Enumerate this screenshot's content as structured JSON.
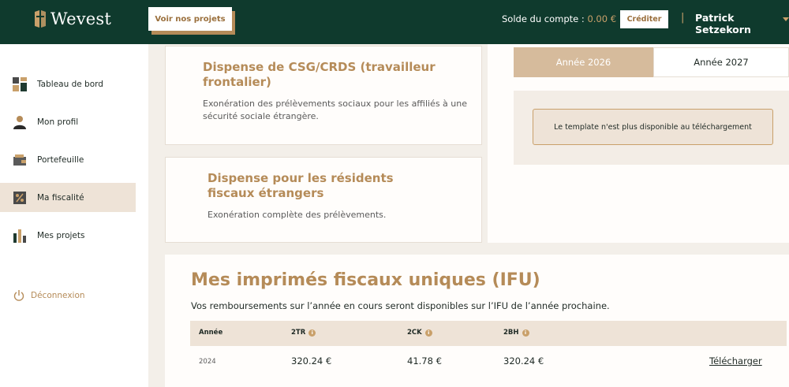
{
  "header": {
    "logo_text": "Wevest",
    "projects_button": "Voir nos projets",
    "balance_label": "Solde du compte :",
    "balance_value": "0.00 €",
    "credit_button": "Créditer",
    "separator": "|",
    "user_name": "Patrick Setzekorn"
  },
  "sidebar": {
    "items": [
      {
        "label": "Tableau de bord",
        "icon": "dashboard-icon"
      },
      {
        "label": "Mon profil",
        "icon": "user-icon"
      },
      {
        "label": "Portefeuille",
        "icon": "wallet-icon"
      },
      {
        "label": "Ma fiscalité",
        "icon": "tax-icon"
      },
      {
        "label": "Mes projets",
        "icon": "chart-bars-icon"
      }
    ],
    "active_index": 3,
    "logout_label": "Déconnexion"
  },
  "cards": [
    {
      "title": "Dispense de CSG/CRDS (travailleur frontalier)",
      "description": "Exonération des prélèvements sociaux pour les affiliés à une sécurité sociale étrangère."
    },
    {
      "title": "Dispense pour les résidents fiscaux étrangers",
      "description": "Exonération complète des prélèvements."
    }
  ],
  "year_tabs": {
    "tabs": [
      "Année 2026",
      "Année 2027"
    ],
    "active_index": 0,
    "notice": "Le template n'est plus disponible au téléchargement"
  },
  "ifu": {
    "title": "Mes imprimés fiscaux uniques (IFU)",
    "subtitle": "Vos remboursements sur l’année en cours seront disponibles sur l’IFU de l’année prochaine.",
    "columns": [
      "Année",
      "2TR",
      "2CK",
      "2BH"
    ],
    "rows": [
      {
        "year": "2024",
        "c2tr": "320.24 €",
        "c2ck": "41.78 €",
        "c2bh": "320.24 €",
        "action": "Télécharger"
      }
    ]
  },
  "colors": {
    "header_bg": "#0f3a2d",
    "accent_gold": "#b58b58",
    "active_tab": "#d6bb9c",
    "active_nav": "#eee3d7"
  }
}
